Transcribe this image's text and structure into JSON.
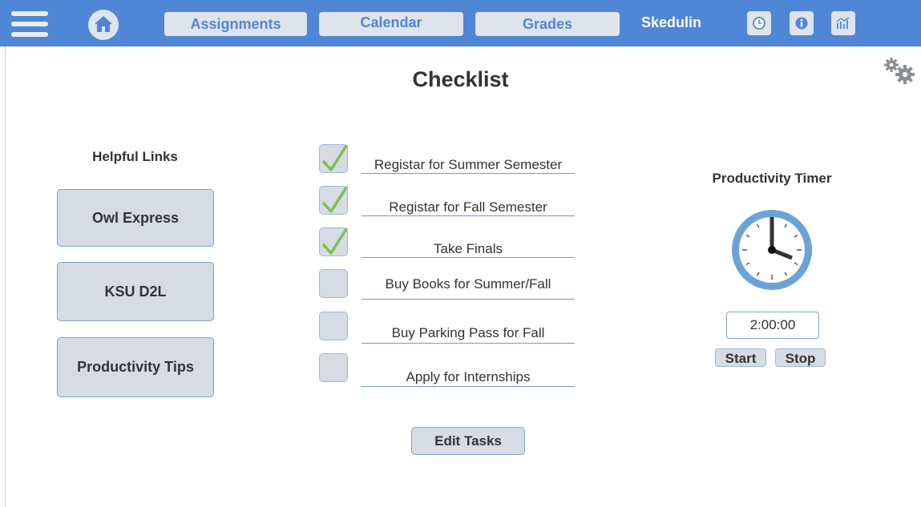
{
  "nav": {
    "tabs": [
      "Assignments",
      "Calendar",
      "Grades"
    ],
    "brand": "Skedulin",
    "icons": [
      "menu-icon",
      "home-icon",
      "clock-icon",
      "info-icon",
      "chart-icon",
      "gear-icon"
    ],
    "accent": "#4f86d6"
  },
  "page": {
    "title": "Checklist"
  },
  "links": {
    "heading": "Helpful Links",
    "items": [
      "Owl Express",
      "KSU D2L",
      "Productivity Tips"
    ]
  },
  "checklist": {
    "tasks": [
      {
        "label": "Registar for Summer Semester",
        "checked": true
      },
      {
        "label": "Registar for Fall Semester",
        "checked": true
      },
      {
        "label": "Take Finals",
        "checked": true
      },
      {
        "label": "Buy Books for Summer/Fall",
        "checked": false
      },
      {
        "label": "Buy Parking Pass for Fall",
        "checked": false
      },
      {
        "label": "Apply for Internships",
        "checked": false
      }
    ],
    "edit_label": "Edit Tasks",
    "check_color": "#7cc04b"
  },
  "timer": {
    "heading": "Productivity Timer",
    "value": "2:00:00",
    "start_label": "Start",
    "stop_label": "Stop"
  }
}
